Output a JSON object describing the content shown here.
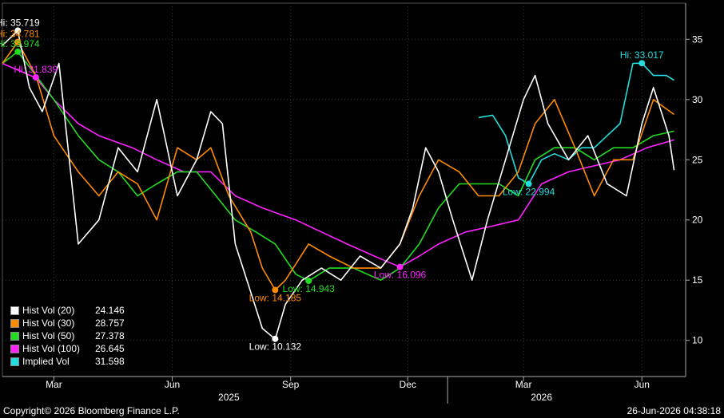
{
  "chart_data": {
    "type": "line",
    "ylim": [
      7,
      38
    ],
    "yticks": [
      10,
      15,
      20,
      25,
      30,
      35
    ],
    "x_month_ticks": [
      {
        "label": "Mar",
        "date": "2025-03-01"
      },
      {
        "label": "Jun",
        "date": "2025-06-01"
      },
      {
        "label": "Sep",
        "date": "2025-09-01"
      },
      {
        "label": "Dec",
        "date": "2025-12-01"
      },
      {
        "label": "Mar",
        "date": "2026-03-01"
      },
      {
        "label": "Jun",
        "date": "2026-06-01"
      }
    ],
    "x_year_labels": [
      {
        "label": "2025",
        "date": "2025-07-15"
      },
      {
        "label": "2026",
        "date": "2026-03-15"
      }
    ],
    "xlim": [
      "2025-01-20",
      "2026-07-05"
    ],
    "series": [
      {
        "name": "Hist Vol (20)",
        "color": "#ffffff",
        "last": "24.146",
        "x": [
          "2025-01-20",
          "2025-02-01",
          "2025-02-10",
          "2025-02-20",
          "2025-03-05",
          "2025-03-20",
          "2025-04-05",
          "2025-04-20",
          "2025-05-05",
          "2025-05-20",
          "2025-06-05",
          "2025-06-20",
          "2025-07-01",
          "2025-07-10",
          "2025-07-20",
          "2025-08-01",
          "2025-08-10",
          "2025-08-20",
          "2025-08-28",
          "2025-09-10",
          "2025-09-25",
          "2025-10-10",
          "2025-10-25",
          "2025-11-10",
          "2025-11-25",
          "2025-12-05",
          "2025-12-15",
          "2025-12-25",
          "2026-01-05",
          "2026-01-20",
          "2026-02-01",
          "2026-02-15",
          "2026-03-01",
          "2026-03-10",
          "2026-03-20",
          "2026-04-05",
          "2026-04-20",
          "2026-05-05",
          "2026-05-20",
          "2026-06-01",
          "2026-06-10",
          "2026-06-22",
          "2026-06-26"
        ],
        "y": [
          34.5,
          35.7,
          31,
          29,
          33,
          18,
          20,
          26,
          24,
          30,
          22,
          25,
          29,
          28,
          18,
          14,
          11,
          10.1,
          13,
          15,
          16,
          15,
          17,
          16,
          18,
          21,
          26,
          24,
          20,
          15,
          20,
          25,
          30,
          32,
          28,
          25,
          27,
          23,
          22,
          28,
          31,
          27,
          24.146
        ]
      },
      {
        "name": "Hist Vol (30)",
        "color": "#ff8c00",
        "last": "28.757",
        "x": [
          "2025-01-20",
          "2025-02-01",
          "2025-02-15",
          "2025-03-01",
          "2025-03-20",
          "2025-04-05",
          "2025-04-20",
          "2025-05-05",
          "2025-05-20",
          "2025-06-05",
          "2025-06-20",
          "2025-07-01",
          "2025-07-15",
          "2025-08-01",
          "2025-08-10",
          "2025-08-20",
          "2025-08-28",
          "2025-09-15",
          "2025-10-01",
          "2025-10-20",
          "2025-11-10",
          "2025-11-25",
          "2025-12-10",
          "2025-12-25",
          "2026-01-10",
          "2026-01-25",
          "2026-02-10",
          "2026-02-25",
          "2026-03-10",
          "2026-03-25",
          "2026-04-10",
          "2026-04-25",
          "2026-05-10",
          "2026-05-25",
          "2026-06-10",
          "2026-06-26"
        ],
        "y": [
          33,
          34.78,
          32,
          27,
          24,
          22,
          24,
          23,
          20,
          26,
          25,
          26,
          22,
          19,
          16,
          14.185,
          15,
          18,
          17,
          16,
          16,
          18,
          22,
          25,
          24,
          22,
          22,
          24,
          28,
          30,
          26,
          22,
          25,
          25,
          30,
          28.757
        ]
      },
      {
        "name": "Hist Vol (50)",
        "color": "#22dd22",
        "last": "27.378",
        "x": [
          "2025-01-20",
          "2025-02-01",
          "2025-02-15",
          "2025-03-01",
          "2025-03-20",
          "2025-04-05",
          "2025-04-20",
          "2025-05-05",
          "2025-05-20",
          "2025-06-05",
          "2025-06-20",
          "2025-07-05",
          "2025-07-20",
          "2025-08-05",
          "2025-08-20",
          "2025-09-05",
          "2025-09-15",
          "2025-10-01",
          "2025-10-20",
          "2025-11-10",
          "2025-11-25",
          "2025-12-10",
          "2025-12-25",
          "2026-01-10",
          "2026-01-25",
          "2026-02-10",
          "2026-02-25",
          "2026-03-10",
          "2026-03-25",
          "2026-04-10",
          "2026-04-25",
          "2026-05-10",
          "2026-05-25",
          "2026-06-10",
          "2026-06-26"
        ],
        "y": [
          33,
          33.974,
          32,
          30,
          27,
          25,
          24,
          22,
          23,
          24,
          24,
          22,
          20,
          19,
          18,
          15.5,
          14.943,
          16,
          16,
          15,
          16,
          18,
          21,
          23,
          23,
          23,
          22,
          25,
          26,
          26,
          25,
          26,
          26,
          27,
          27.378
        ]
      },
      {
        "name": "Hist Vol (100)",
        "color": "#ff22ff",
        "last": "26.645",
        "x": [
          "2025-01-20",
          "2025-02-15",
          "2025-03-01",
          "2025-03-20",
          "2025-04-05",
          "2025-05-01",
          "2025-05-20",
          "2025-06-10",
          "2025-07-01",
          "2025-07-20",
          "2025-08-10",
          "2025-09-05",
          "2025-09-25",
          "2025-10-15",
          "2025-11-05",
          "2025-11-25",
          "2025-12-10",
          "2025-12-25",
          "2026-01-15",
          "2026-02-05",
          "2026-02-25",
          "2026-03-15",
          "2026-04-05",
          "2026-04-25",
          "2026-05-15",
          "2026-06-05",
          "2026-06-26"
        ],
        "y": [
          33,
          31.8,
          30,
          28,
          27,
          26,
          25,
          24,
          24,
          22,
          21,
          20,
          19,
          18,
          17,
          16.096,
          17,
          18,
          19,
          19.5,
          20,
          23,
          24,
          24.5,
          25,
          26,
          26.645
        ]
      },
      {
        "name": "Implied Vol",
        "color": "#22dddd",
        "last": "31.598",
        "x": [
          "2026-01-25",
          "2026-02-05",
          "2026-02-15",
          "2026-02-25",
          "2026-03-05",
          "2026-03-15",
          "2026-03-25",
          "2026-04-05",
          "2026-04-15",
          "2026-04-25",
          "2026-05-05",
          "2026-05-15",
          "2026-05-25",
          "2026-06-01",
          "2026-06-10",
          "2026-06-20",
          "2026-06-26"
        ],
        "y": [
          28.5,
          28.7,
          27,
          23.5,
          22.994,
          25,
          25.5,
          25,
          26,
          26,
          27,
          28,
          33,
          33.017,
          32,
          32,
          31.598
        ]
      }
    ],
    "annotations": [
      {
        "text": "Hi: 35.719",
        "series": 0,
        "date": "2025-02-01",
        "value": 35.719,
        "color": "#ffffff"
      },
      {
        "text": "Low: 10.132",
        "series": 0,
        "date": "2025-08-20",
        "value": 10.132,
        "color": "#ffffff"
      },
      {
        "text": "Hi: 34.781",
        "series": 1,
        "date": "2025-02-01",
        "value": 34.781,
        "color": "#ff8c00"
      },
      {
        "text": "Low: 14.185",
        "series": 1,
        "date": "2025-08-20",
        "value": 14.185,
        "color": "#ff8c00"
      },
      {
        "text": "Hi: 33.974",
        "series": 2,
        "date": "2025-02-01",
        "value": 33.974,
        "color": "#22dd22"
      },
      {
        "text": "Low: 14.943",
        "series": 2,
        "date": "2025-09-15",
        "value": 14.943,
        "color": "#22dd22"
      },
      {
        "text": "Hi: 31.839",
        "series": 3,
        "date": "2025-02-15",
        "value": 31.839,
        "color": "#ff22ff"
      },
      {
        "text": "Low: 16.096",
        "series": 3,
        "date": "2025-11-25",
        "value": 16.096,
        "color": "#ff22ff"
      },
      {
        "text": "Hi: 33.017",
        "series": 4,
        "date": "2026-06-01",
        "value": 33.017,
        "color": "#22dddd"
      },
      {
        "text": "Low: 22.994",
        "series": 4,
        "date": "2026-03-05",
        "value": 22.994,
        "color": "#22dddd"
      }
    ],
    "legend_placement": "bottom-left",
    "grid": true
  },
  "footer": {
    "copyright": "Copyright© 2026 Bloomberg Finance L.P.",
    "timestamp": "26-Jun-2026 04:38:18"
  }
}
